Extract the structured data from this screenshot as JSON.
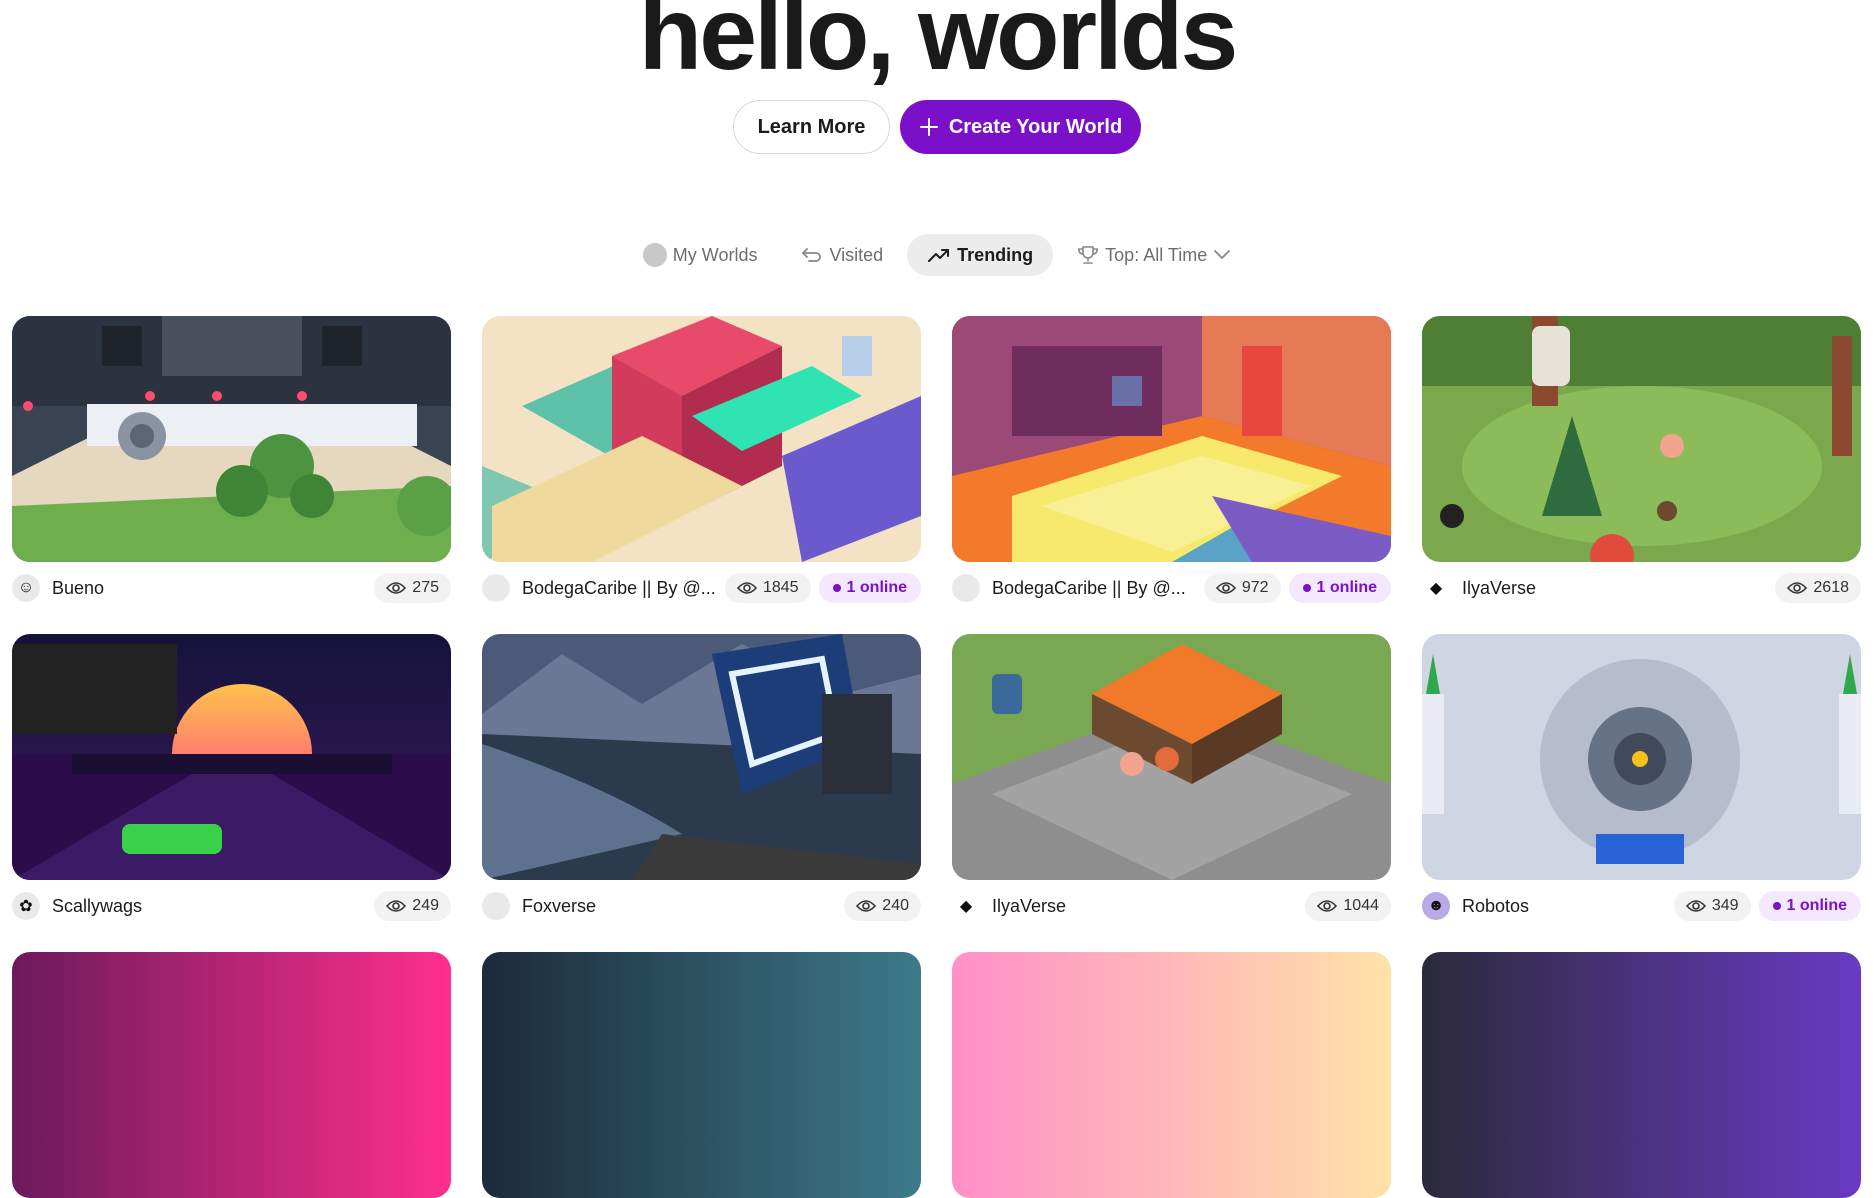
{
  "hero": {
    "title": "hello, worlds",
    "learn_more": "Learn More",
    "create": "Create Your World"
  },
  "filters": {
    "my_worlds": "My Worlds",
    "visited": "Visited",
    "trending": "Trending",
    "top": "Top: All Time"
  },
  "accent_color": "#7a11c9",
  "cards": [
    {
      "title": "Bueno",
      "views": "275",
      "online": null,
      "creator_icon": "bueno-logo-icon"
    },
    {
      "title": "BodegaCaribe || By @...",
      "views": "1845",
      "online": "1 online",
      "creator_icon": "default-avatar-icon"
    },
    {
      "title": "BodegaCaribe || By @...",
      "views": "972",
      "online": "1 online",
      "creator_icon": "default-avatar-icon"
    },
    {
      "title": "IlyaVerse",
      "views": "2618",
      "online": null,
      "creator_icon": "diamond-icon"
    },
    {
      "title": "Scallywags",
      "views": "249",
      "online": null,
      "creator_icon": "scallywags-logo-icon"
    },
    {
      "title": "Foxverse",
      "views": "240",
      "online": null,
      "creator_icon": "default-avatar-icon"
    },
    {
      "title": "IlyaVerse",
      "views": "1044",
      "online": null,
      "creator_icon": "diamond-icon"
    },
    {
      "title": "Robotos",
      "views": "349",
      "online": "1 online",
      "creator_icon": "robotos-logo-icon"
    }
  ]
}
